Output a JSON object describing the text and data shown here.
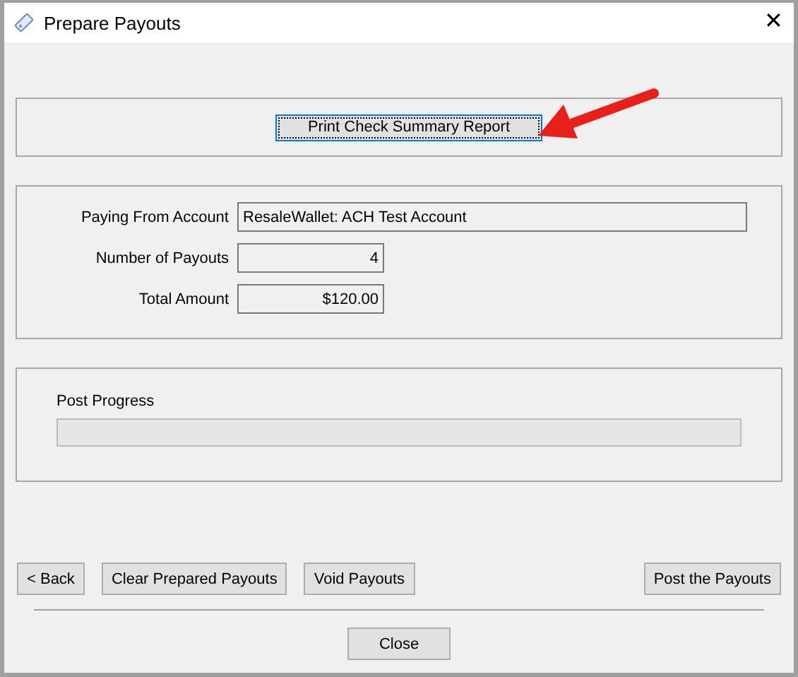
{
  "window": {
    "title": "Prepare Payouts",
    "close": "✕"
  },
  "report_button": "Print Check Summary Report",
  "fields": [
    {
      "label": "Paying From Account",
      "value": "ResaleWallet: ACH Test Account",
      "kind": "wide"
    },
    {
      "label": "Number of Payouts",
      "value": "4",
      "kind": "number"
    },
    {
      "label": "Total Amount",
      "value": "$120.00",
      "kind": "number"
    }
  ],
  "progress": {
    "label": "Post Progress"
  },
  "actions": [
    {
      "label": "< Back",
      "kind": "left"
    },
    {
      "label": "Clear Prepared Payouts",
      "kind": "left"
    },
    {
      "label": "Void Payouts",
      "kind": "left"
    },
    {
      "label": "Post the Payouts",
      "kind": "right"
    }
  ],
  "close_button": "Close"
}
